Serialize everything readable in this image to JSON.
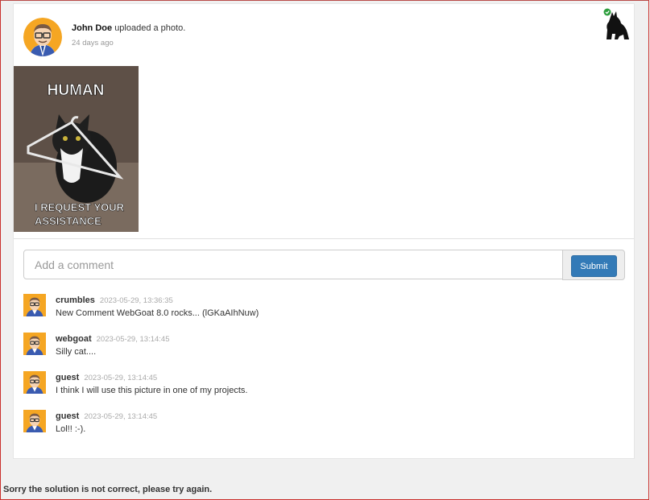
{
  "post": {
    "author": "John Doe",
    "action": "uploaded a photo.",
    "time": "24 days ago",
    "photo": {
      "top_text": "HUMAN",
      "bottom_text_1": "I REQUEST YOUR",
      "bottom_text_2": "ASSISTANCE"
    }
  },
  "comment_form": {
    "placeholder": "Add a comment",
    "submit_label": "Submit"
  },
  "comments": [
    {
      "user": "crumbles",
      "time": "2023-05-29, 13:36:35",
      "text": "New Comment WebGoat 8.0 rocks... (lGKaAIhNuw)"
    },
    {
      "user": "webgoat",
      "time": "2023-05-29, 13:14:45",
      "text": "Silly cat...."
    },
    {
      "user": "guest",
      "time": "2023-05-29, 13:14:45",
      "text": "I think I will use this picture in one of my projects."
    },
    {
      "user": "guest",
      "time": "2023-05-29, 13:14:45",
      "text": "Lol!! :-)."
    }
  ],
  "feedback": "Sorry the solution is not correct, please try again.",
  "colors": {
    "submit": "#337ab7",
    "avatar_bg": "#f5a623",
    "success_badge": "#2e9e3e"
  }
}
